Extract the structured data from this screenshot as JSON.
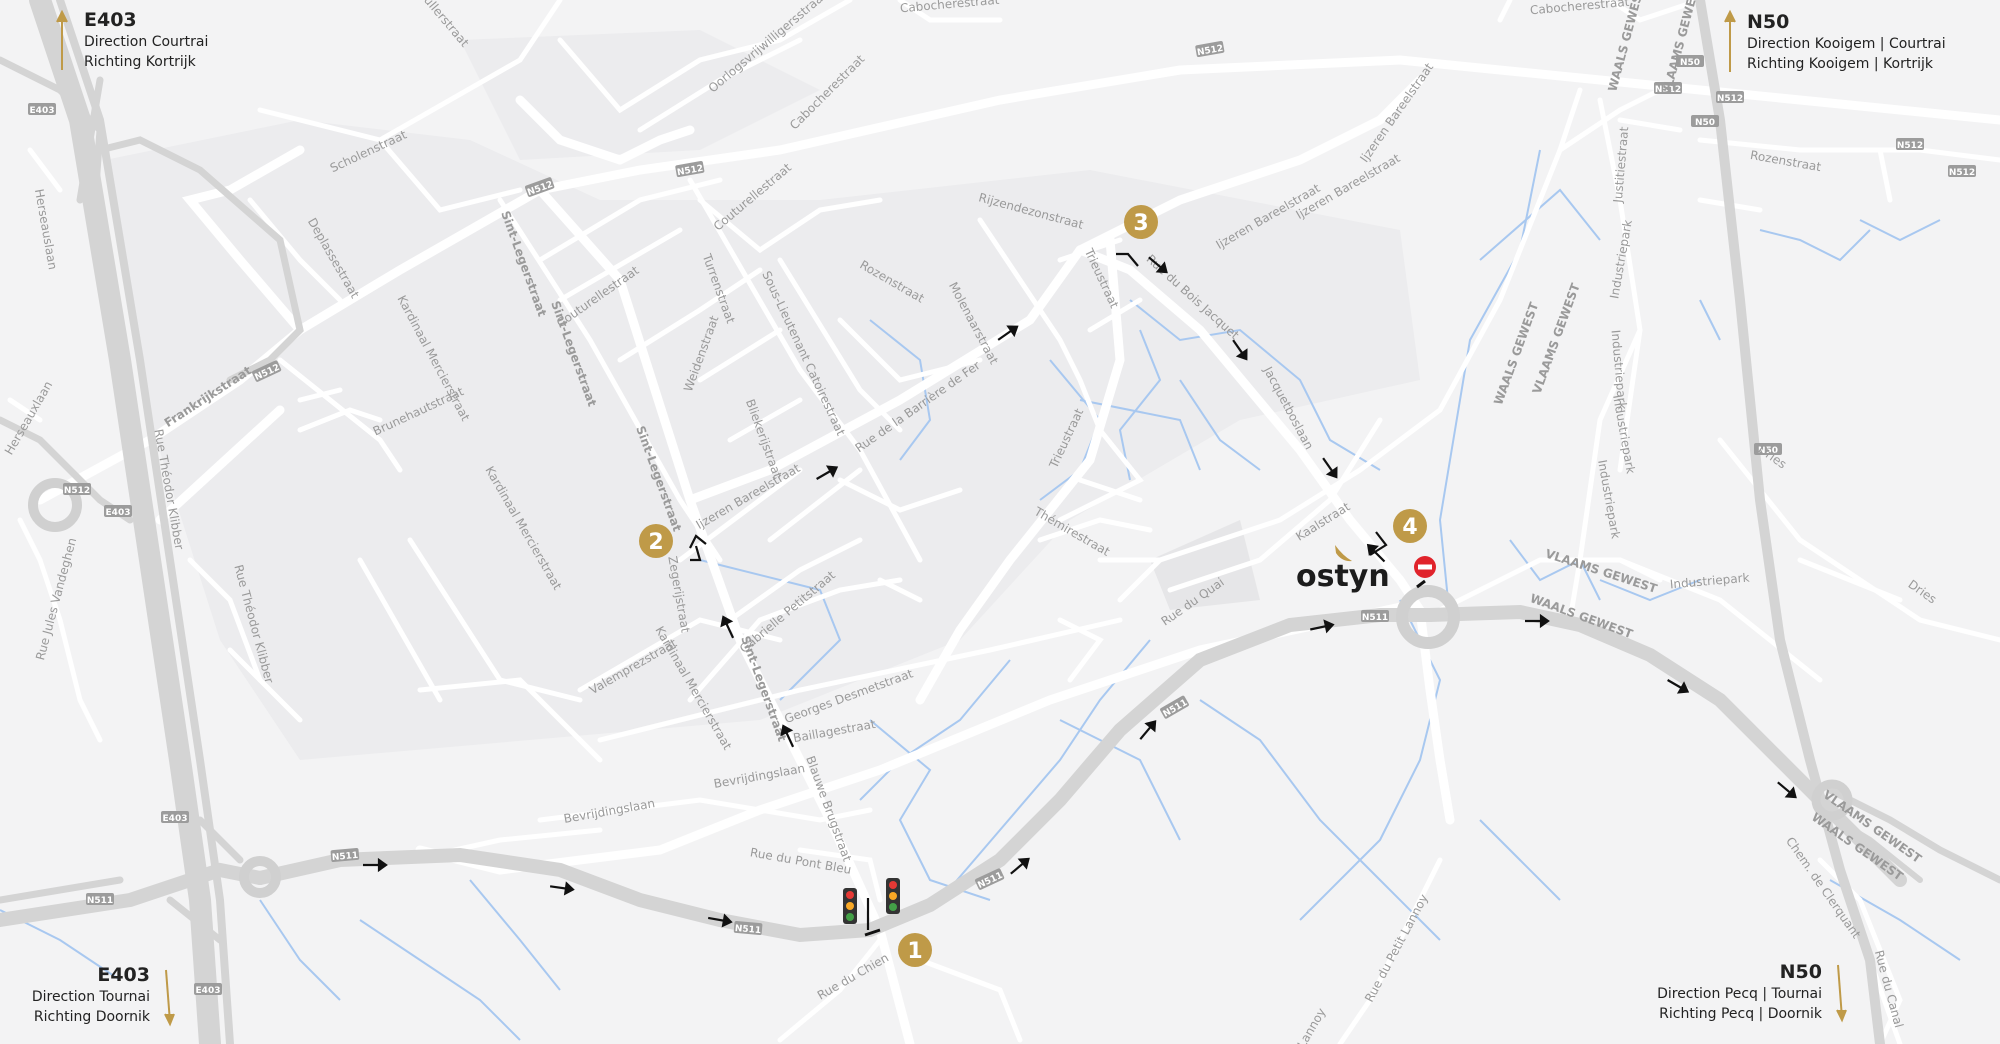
{
  "colors": {
    "background": "#f3f3f4",
    "built_area": "#ececee",
    "road": "#ffffff",
    "highway": "#d6d6d6",
    "water": "#a8c8f0",
    "marker": "#bf9a48",
    "route_arrow": "#111111",
    "no_entry": "#e0232b"
  },
  "corners": {
    "top_left": {
      "road": "E403",
      "line1": "Direction Courtrai",
      "line2": "Richting Kortrijk",
      "arrow": "up"
    },
    "top_right": {
      "road": "N50",
      "line1": "Direction Kooigem | Courtrai",
      "line2": "Richting Kooigem | Kortrijk",
      "arrow": "up"
    },
    "bottom_left": {
      "road": "E403",
      "line1": "Direction Tournai",
      "line2": "Richting Doornik",
      "arrow": "down"
    },
    "bottom_right": {
      "road": "N50",
      "line1": "Direction Pecq | Tournai",
      "line2": "Richting Pecq | Doornik",
      "arrow": "down"
    }
  },
  "markers": [
    {
      "label": "1"
    },
    {
      "label": "2"
    },
    {
      "label": "3"
    },
    {
      "label": "4"
    }
  ],
  "destination": {
    "logo": "ostyn"
  },
  "icons": [
    "traffic-light-icon",
    "traffic-light-icon",
    "no-entry-icon"
  ],
  "road_shields": {
    "n512": "N512",
    "n511": "N511",
    "e403": "E403",
    "n50": "N50"
  },
  "streets": {
    "frankrijkstraat": "Frankrijkstraat",
    "scholenstraat": "Scholenstraat",
    "deplassestraat": "Deplassestraat",
    "herseauxlaan": "Herseauxlaan",
    "herseauslaan": "Herseauslaan",
    "rue_theodor_klibber": "Rue Théodor Klibber",
    "rue_theodor_klibber2": "Rue Théodor Klibber",
    "rue_jules_vandeghen": "Rue Jules Vandeghen",
    "kardinaal_mercierstraat_1": "Kardinaal Mercierstraat",
    "kardinaal_mercierstraat_2": "Kardinaal Mercierstraat",
    "kardinaal_mercierstraat_3": "Kardinaal Mercierstraat",
    "brunehautstraat": "Brunehautstraat",
    "sint_legerstraat_1": "Sint-Legerstraat",
    "sint_legerstraat_2": "Sint-Legerstraat",
    "sint_legerstraat_3": "Sint-Legerstraat",
    "sint_legerstraat_4": "Sint-Legerstraat",
    "couturellestraat_1": "Couturellestraat",
    "couturellestraat_2": "Couturellestraat",
    "turrenstraat": "Turrenstraat",
    "weidenstraat": "Weidenstraat",
    "sous_lieutenant_catoirestraat": "Sous-Lieutenant Catoirestraat",
    "bliekerijstraat": "Bliekerijstraat",
    "ijzeren_bareelstraat_1": "Ijzeren Bareelstraat",
    "ijzeren_bareelstraat_2": "Ijzeren Bareelstraat",
    "ijzeren_bareelstraat_3": "Ijzeren Bareelstraat",
    "rue_de_la_barriere_de_fer": "Rue de la Barrière de Fer",
    "rozenstraat": "Rozenstraat",
    "molenaarstraat": "Molenaarstraat",
    "rijzendezonstraat": "Rijzendezonstraat",
    "trieustraat_1": "Trieustraat",
    "trieustraat_2": "Trieustraat",
    "rue_du_bois_jacquet": "Rue du Bois Jacquet",
    "jacquetboslaan": "Jacquetboslaan",
    "themiresraat": "Thémirestraat",
    "kaalstraat": "Kaalstraat",
    "rue_du_quai": "Rue du Quai",
    "gabrielle_petitstraat": "Gabrielle Petitstraat",
    "zegerijstraat": "Zegerijstraat",
    "valemprezstraat": "Valemprezstraat",
    "georges_desmetstraat": "Georges Desmetstraat",
    "baillagestraat": "Baillagestraat",
    "bevrijdingslaan_1": "Bevrijdingslaan",
    "bevrijdingslaan_2": "Bevrijdingslaan",
    "blauwe_brugstraat": "Blauwe Brugstraat",
    "rue_du_pont_bleu": "Rue du Pont Bleu",
    "rue_du_chien": "Rue du Chien",
    "rue_du_petit_lannoy": "Rue du Petit Lannoy",
    "lannoy": "Lannoy",
    "oorlogsvrijwilligersstraat": "Oorlogsvrijwilligersstraat",
    "cabocherestraat_1": "Cabocherestraat",
    "cabocherestraat_2": "Cabocherestraat",
    "cabocherestraat_3": "Cabocherestraat",
    "mullerstraat": "Mullerstraat",
    "ijzeren_bareelstraat_n": "Ijzeren Bareelstraat",
    "justitiestraat": "Justitiestraat",
    "rozenstraat_e": "Rozenstraat",
    "industriepark_1": "Industriepark",
    "industriepark_2": "Industriepark",
    "industriepark_3": "Industriepark",
    "industriepark_4": "Industriepark",
    "industriepark_5": "Industriepark",
    "dries_1": "Dries",
    "dries_2": "Dries",
    "chem_de_clerquant": "Chem. de Clerquant",
    "rue_du_canal": "Rue du Canal",
    "waals_gewest_1": "WAALS GEWEST",
    "waals_gewest_2": "WAALS GEWEST",
    "waals_gewest_3": "WAALS GEWEST",
    "waals_gewest_4": "WAALS GEWEST",
    "vlaams_gewest_1": "VLAAMS GEWEST",
    "vlaams_gewest_2": "VLAAMS GEWEST",
    "vlaams_gewest_3": "VLAAMS GEWEST",
    "vlaams_gewest_4": "VLAAMS GEWEST"
  }
}
